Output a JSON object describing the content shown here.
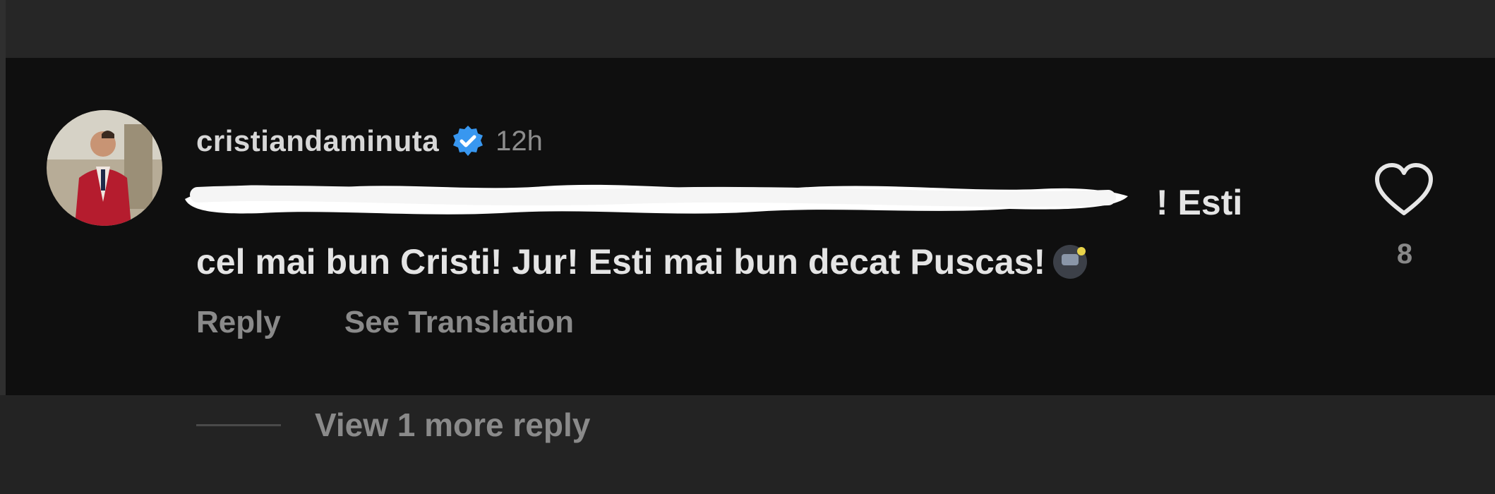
{
  "comment": {
    "username": "cristiandaminuta",
    "timestamp": "12h",
    "text_line1_tail": "! Esti",
    "text_line2": "cel mai bun Cristi! Jur! Esti mai bun decat Puscas!",
    "redaction_color": "#ffffff",
    "likes": "8"
  },
  "actions": {
    "reply": "Reply",
    "see_translation": "See Translation"
  },
  "replies": {
    "view_more": "View 1 more reply"
  },
  "colors": {
    "background": "#0f0f0f",
    "verified": "#3897f0",
    "text": "#e4e4e4",
    "muted": "#8a8a8a"
  }
}
